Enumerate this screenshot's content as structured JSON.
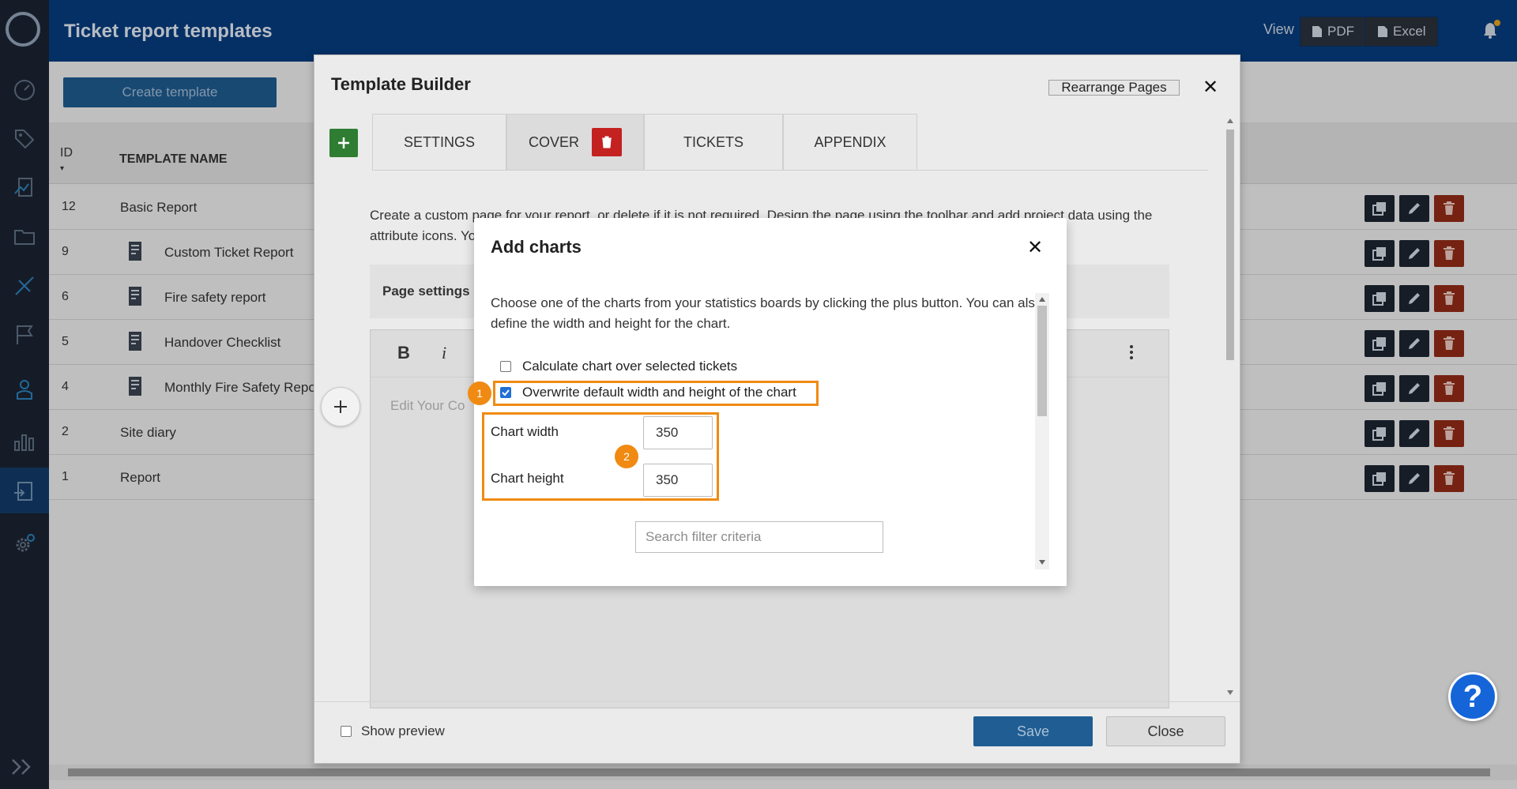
{
  "app": {
    "page_title": "Ticket report templates",
    "view_label": "View",
    "view_pdf": "PDF",
    "view_excel": "Excel",
    "help_label": "?"
  },
  "list": {
    "create_label": "Create template",
    "col_id": "ID",
    "col_name": "TEMPLATE NAME",
    "rows": [
      {
        "id": "12",
        "name": "Basic Report",
        "child": false
      },
      {
        "id": "9",
        "name": "Custom Ticket Report",
        "child": true
      },
      {
        "id": "6",
        "name": "Fire safety report",
        "child": true
      },
      {
        "id": "5",
        "name": "Handover Checklist",
        "child": true
      },
      {
        "id": "4",
        "name": "Monthly Fire Safety Repo",
        "child": true
      },
      {
        "id": "2",
        "name": "Site diary",
        "child": false
      },
      {
        "id": "1",
        "name": "Report",
        "child": false
      }
    ]
  },
  "builder": {
    "title": "Template Builder",
    "rearrange_label": "Rearrange Pages",
    "close_glyph": "✕",
    "add_glyph": "+",
    "tabs": [
      {
        "label": "SETTINGS"
      },
      {
        "label": "COVER"
      },
      {
        "label": "TICKETS"
      },
      {
        "label": "APPENDIX"
      }
    ],
    "description": "Create a custom page for your report, or delete if it is not required. Design the page using the toolbar and add project data using the attribute icons. Yo",
    "page_settings_label": "Page settings",
    "toolbar_bold": "B",
    "toolbar_italic": "i",
    "editor_placeholder": "Edit Your Co",
    "show_preview_label": "Show preview",
    "save_label": "Save",
    "close_label": "Close"
  },
  "charts_dialog": {
    "title": "Add charts",
    "close_glyph": "✕",
    "intro": "Choose one of the charts from your statistics boards by clicking the plus button. You can also define the width and height for the chart.",
    "calc_label": "Calculate chart over selected tickets",
    "overwrite_label": "Overwrite default width and height of the chart",
    "badge_1": "1",
    "badge_2": "2",
    "width_label": "Chart width",
    "width_value": "350",
    "height_label": "Chart height",
    "height_value": "350",
    "search_placeholder": "Search filter criteria"
  },
  "colors": {
    "topbar": "#073b7c",
    "sidebar": "#1a2331",
    "highlight": "#f08a12",
    "primary": "#1f5d92",
    "danger": "#c42121",
    "success": "#2e7d32"
  }
}
